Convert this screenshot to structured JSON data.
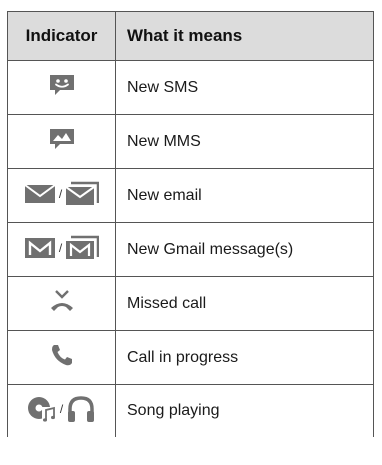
{
  "table": {
    "headers": {
      "indicator": "Indicator",
      "meaning": "What it means"
    },
    "separator": "/",
    "rows": [
      {
        "meaning": "New SMS",
        "icons": [
          "sms-smiley-icon"
        ]
      },
      {
        "meaning": "New MMS",
        "icons": [
          "mms-picture-icon"
        ]
      },
      {
        "meaning": "New email",
        "icons": [
          "envelope-icon",
          "envelope-stack-icon"
        ]
      },
      {
        "meaning": "New Gmail message(s)",
        "icons": [
          "gmail-icon",
          "gmail-stack-icon"
        ]
      },
      {
        "meaning": "Missed call",
        "icons": [
          "missed-call-icon"
        ]
      },
      {
        "meaning": "Call in progress",
        "icons": [
          "phone-handset-icon"
        ]
      },
      {
        "meaning": "Song playing",
        "icons": [
          "music-note-icon",
          "headphones-icon"
        ]
      }
    ]
  },
  "colors": {
    "header_bg": "#dcdcdc",
    "icon": "#707070",
    "border": "#555555"
  }
}
